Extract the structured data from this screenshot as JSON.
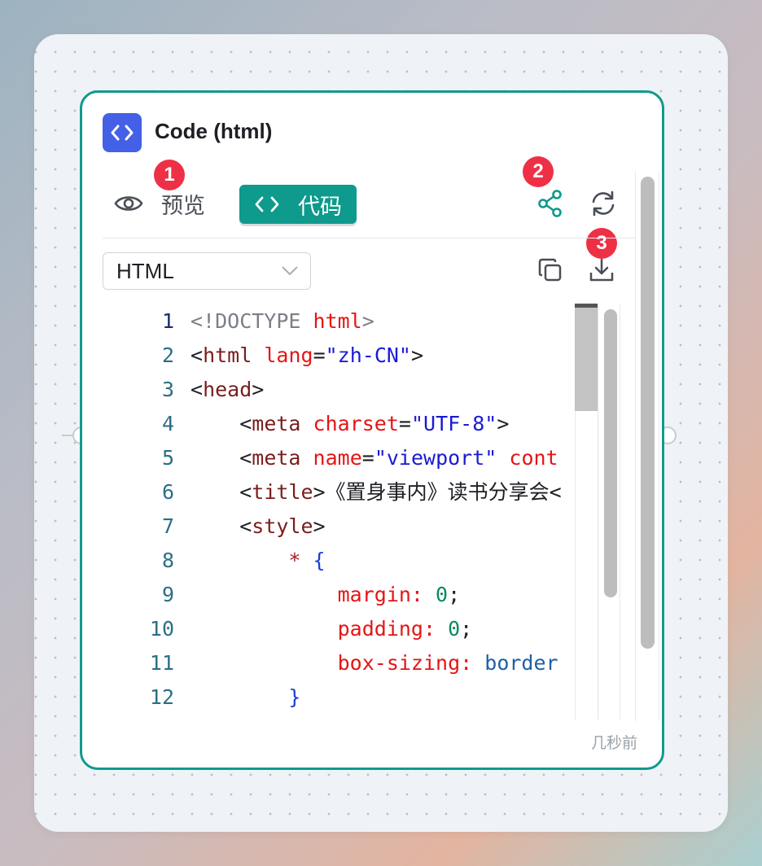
{
  "node": {
    "title": "Code (html)",
    "timestamp": "几秒前"
  },
  "tabs": {
    "preview_label": "预览",
    "code_label": "代码",
    "active": "code"
  },
  "badges": [
    "1",
    "2",
    "3"
  ],
  "toolbar": {
    "share_icon": "share-icon",
    "refresh_icon": "refresh-icon",
    "copy_icon": "copy-icon",
    "download_icon": "download-icon"
  },
  "language_select": {
    "selected": "HTML"
  },
  "editor": {
    "lines": [
      {
        "n": "1",
        "tokens": [
          [
            "grey",
            "<!DOCTYPE "
          ],
          [
            "attr",
            "html"
          ],
          [
            "grey",
            ">"
          ]
        ]
      },
      {
        "n": "2",
        "tokens": [
          [
            "plain",
            "<"
          ],
          [
            "tag",
            "html"
          ],
          [
            "plain",
            " "
          ],
          [
            "attr",
            "lang"
          ],
          [
            "plain",
            "="
          ],
          [
            "str",
            "\"zh-CN\""
          ],
          [
            "plain",
            ">"
          ]
        ]
      },
      {
        "n": "3",
        "tokens": [
          [
            "plain",
            "<"
          ],
          [
            "tag",
            "head"
          ],
          [
            "plain",
            ">"
          ]
        ]
      },
      {
        "n": "4",
        "tokens": [
          [
            "plain",
            "    <"
          ],
          [
            "tag",
            "meta"
          ],
          [
            "plain",
            " "
          ],
          [
            "attr",
            "charset"
          ],
          [
            "plain",
            "="
          ],
          [
            "str",
            "\"UTF-8\""
          ],
          [
            "plain",
            ">"
          ]
        ]
      },
      {
        "n": "5",
        "tokens": [
          [
            "plain",
            "    <"
          ],
          [
            "tag",
            "meta"
          ],
          [
            "plain",
            " "
          ],
          [
            "attr",
            "name"
          ],
          [
            "plain",
            "="
          ],
          [
            "str",
            "\"viewport\""
          ],
          [
            "plain",
            " "
          ],
          [
            "attr",
            "cont"
          ]
        ]
      },
      {
        "n": "6",
        "tokens": [
          [
            "plain",
            "    <"
          ],
          [
            "tag",
            "title"
          ],
          [
            "plain",
            ">《置身事内》读书分享会<"
          ]
        ]
      },
      {
        "n": "7",
        "tokens": [
          [
            "plain",
            "    <"
          ],
          [
            "tag",
            "style"
          ],
          [
            "plain",
            ">"
          ]
        ]
      },
      {
        "n": "8",
        "tokens": [
          [
            "plain",
            "        "
          ],
          [
            "sel",
            "*"
          ],
          [
            "plain",
            " "
          ],
          [
            "blue",
            "{"
          ]
        ]
      },
      {
        "n": "9",
        "tokens": [
          [
            "plain",
            "            "
          ],
          [
            "attr",
            "margin:"
          ],
          [
            "plain",
            " "
          ],
          [
            "num",
            "0"
          ],
          [
            "plain",
            ";"
          ]
        ]
      },
      {
        "n": "10",
        "tokens": [
          [
            "plain",
            "            "
          ],
          [
            "attr",
            "padding:"
          ],
          [
            "plain",
            " "
          ],
          [
            "num",
            "0"
          ],
          [
            "plain",
            ";"
          ]
        ]
      },
      {
        "n": "11",
        "tokens": [
          [
            "plain",
            "            "
          ],
          [
            "attr",
            "box-sizing:"
          ],
          [
            "plain",
            " "
          ],
          [
            "val",
            "border"
          ]
        ]
      },
      {
        "n": "12",
        "tokens": [
          [
            "plain",
            "        "
          ],
          [
            "blue",
            "}"
          ]
        ]
      }
    ]
  },
  "colors": {
    "accent": "#0e9a8c",
    "border": "#119a8e",
    "header_icon_bg": "#4460e6",
    "badge": "#ee3046"
  }
}
